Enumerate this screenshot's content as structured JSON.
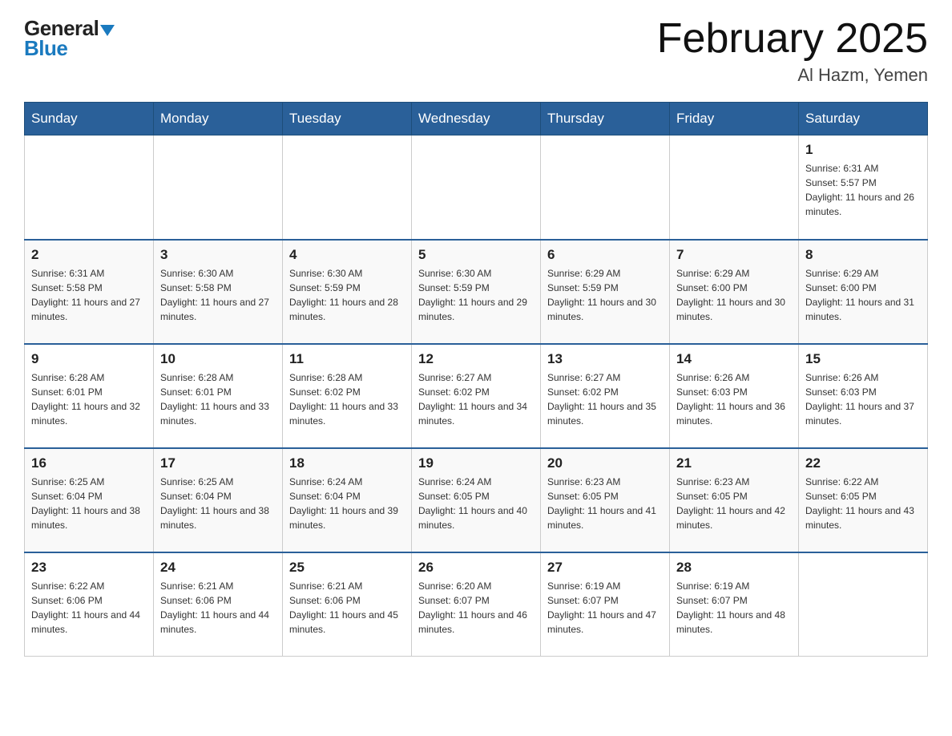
{
  "header": {
    "logo_general": "General",
    "logo_blue": "Blue",
    "month_title": "February 2025",
    "location": "Al Hazm, Yemen"
  },
  "weekdays": [
    "Sunday",
    "Monday",
    "Tuesday",
    "Wednesday",
    "Thursday",
    "Friday",
    "Saturday"
  ],
  "rows": [
    {
      "cells": [
        {
          "day": "",
          "info": ""
        },
        {
          "day": "",
          "info": ""
        },
        {
          "day": "",
          "info": ""
        },
        {
          "day": "",
          "info": ""
        },
        {
          "day": "",
          "info": ""
        },
        {
          "day": "",
          "info": ""
        },
        {
          "day": "1",
          "info": "Sunrise: 6:31 AM\nSunset: 5:57 PM\nDaylight: 11 hours and 26 minutes."
        }
      ]
    },
    {
      "cells": [
        {
          "day": "2",
          "info": "Sunrise: 6:31 AM\nSunset: 5:58 PM\nDaylight: 11 hours and 27 minutes."
        },
        {
          "day": "3",
          "info": "Sunrise: 6:30 AM\nSunset: 5:58 PM\nDaylight: 11 hours and 27 minutes."
        },
        {
          "day": "4",
          "info": "Sunrise: 6:30 AM\nSunset: 5:59 PM\nDaylight: 11 hours and 28 minutes."
        },
        {
          "day": "5",
          "info": "Sunrise: 6:30 AM\nSunset: 5:59 PM\nDaylight: 11 hours and 29 minutes."
        },
        {
          "day": "6",
          "info": "Sunrise: 6:29 AM\nSunset: 5:59 PM\nDaylight: 11 hours and 30 minutes."
        },
        {
          "day": "7",
          "info": "Sunrise: 6:29 AM\nSunset: 6:00 PM\nDaylight: 11 hours and 30 minutes."
        },
        {
          "day": "8",
          "info": "Sunrise: 6:29 AM\nSunset: 6:00 PM\nDaylight: 11 hours and 31 minutes."
        }
      ]
    },
    {
      "cells": [
        {
          "day": "9",
          "info": "Sunrise: 6:28 AM\nSunset: 6:01 PM\nDaylight: 11 hours and 32 minutes."
        },
        {
          "day": "10",
          "info": "Sunrise: 6:28 AM\nSunset: 6:01 PM\nDaylight: 11 hours and 33 minutes."
        },
        {
          "day": "11",
          "info": "Sunrise: 6:28 AM\nSunset: 6:02 PM\nDaylight: 11 hours and 33 minutes."
        },
        {
          "day": "12",
          "info": "Sunrise: 6:27 AM\nSunset: 6:02 PM\nDaylight: 11 hours and 34 minutes."
        },
        {
          "day": "13",
          "info": "Sunrise: 6:27 AM\nSunset: 6:02 PM\nDaylight: 11 hours and 35 minutes."
        },
        {
          "day": "14",
          "info": "Sunrise: 6:26 AM\nSunset: 6:03 PM\nDaylight: 11 hours and 36 minutes."
        },
        {
          "day": "15",
          "info": "Sunrise: 6:26 AM\nSunset: 6:03 PM\nDaylight: 11 hours and 37 minutes."
        }
      ]
    },
    {
      "cells": [
        {
          "day": "16",
          "info": "Sunrise: 6:25 AM\nSunset: 6:04 PM\nDaylight: 11 hours and 38 minutes."
        },
        {
          "day": "17",
          "info": "Sunrise: 6:25 AM\nSunset: 6:04 PM\nDaylight: 11 hours and 38 minutes."
        },
        {
          "day": "18",
          "info": "Sunrise: 6:24 AM\nSunset: 6:04 PM\nDaylight: 11 hours and 39 minutes."
        },
        {
          "day": "19",
          "info": "Sunrise: 6:24 AM\nSunset: 6:05 PM\nDaylight: 11 hours and 40 minutes."
        },
        {
          "day": "20",
          "info": "Sunrise: 6:23 AM\nSunset: 6:05 PM\nDaylight: 11 hours and 41 minutes."
        },
        {
          "day": "21",
          "info": "Sunrise: 6:23 AM\nSunset: 6:05 PM\nDaylight: 11 hours and 42 minutes."
        },
        {
          "day": "22",
          "info": "Sunrise: 6:22 AM\nSunset: 6:05 PM\nDaylight: 11 hours and 43 minutes."
        }
      ]
    },
    {
      "cells": [
        {
          "day": "23",
          "info": "Sunrise: 6:22 AM\nSunset: 6:06 PM\nDaylight: 11 hours and 44 minutes."
        },
        {
          "day": "24",
          "info": "Sunrise: 6:21 AM\nSunset: 6:06 PM\nDaylight: 11 hours and 44 minutes."
        },
        {
          "day": "25",
          "info": "Sunrise: 6:21 AM\nSunset: 6:06 PM\nDaylight: 11 hours and 45 minutes."
        },
        {
          "day": "26",
          "info": "Sunrise: 6:20 AM\nSunset: 6:07 PM\nDaylight: 11 hours and 46 minutes."
        },
        {
          "day": "27",
          "info": "Sunrise: 6:19 AM\nSunset: 6:07 PM\nDaylight: 11 hours and 47 minutes."
        },
        {
          "day": "28",
          "info": "Sunrise: 6:19 AM\nSunset: 6:07 PM\nDaylight: 11 hours and 48 minutes."
        },
        {
          "day": "",
          "info": ""
        }
      ]
    }
  ]
}
